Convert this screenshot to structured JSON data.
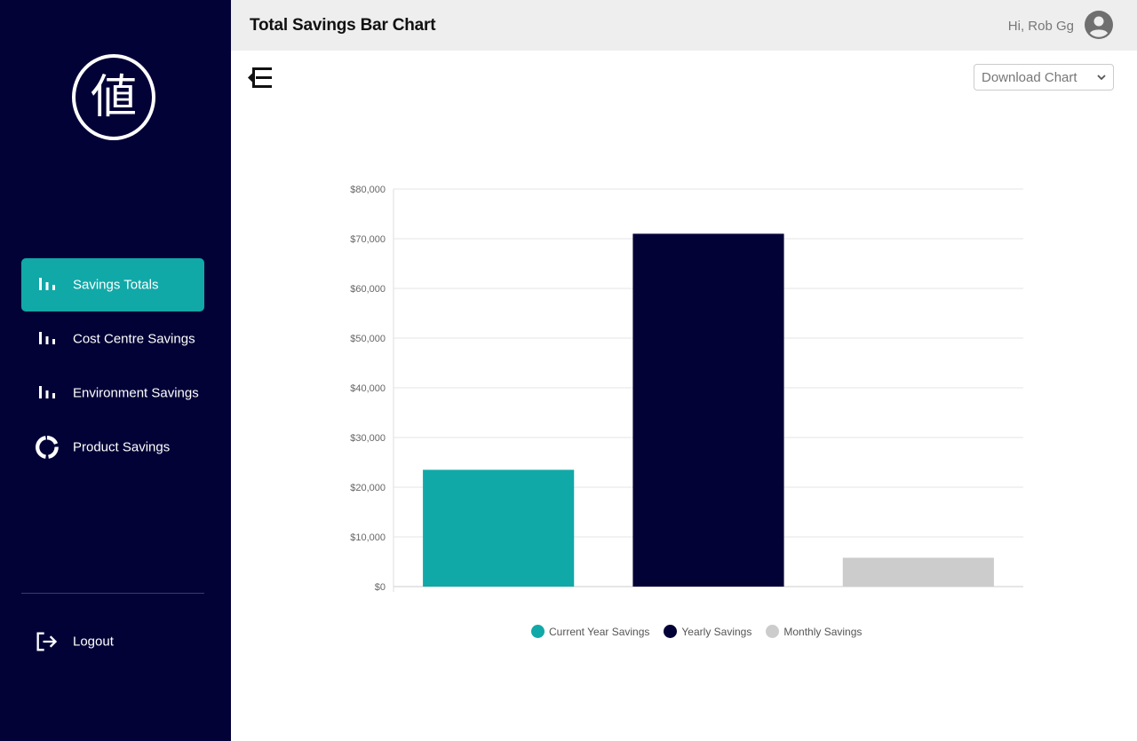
{
  "sidebar": {
    "logo_char": "値",
    "items": [
      {
        "label": "Savings Totals",
        "icon": "bar-chart-icon",
        "active": true
      },
      {
        "label": "Cost Centre Savings",
        "icon": "bar-chart-icon",
        "active": false
      },
      {
        "label": "Environment Savings",
        "icon": "bar-chart-icon",
        "active": false
      },
      {
        "label": "Product Savings",
        "icon": "donut-chart-icon",
        "active": false
      }
    ],
    "logout_label": "Logout"
  },
  "header": {
    "title": "Total Savings Bar Chart",
    "greeting": "Hi, Rob Gg"
  },
  "toolbar": {
    "download_label": "Download Chart"
  },
  "colors": {
    "sidebar_bg": "#020237",
    "accent": "#11a8a8",
    "yearly": "#020237",
    "monthly": "#cccccc"
  },
  "chart_data": {
    "type": "bar",
    "categories": [
      "Current Year Savings",
      "Yearly Savings",
      "Monthly Savings"
    ],
    "values": [
      23500,
      71000,
      5800
    ],
    "colors": [
      "#11a8a8",
      "#020237",
      "#cccccc"
    ],
    "ylim": [
      0,
      80000
    ],
    "yticks": [
      "$0",
      "$10,000",
      "$20,000",
      "$30,000",
      "$40,000",
      "$50,000",
      "$60,000",
      "$70,000",
      "$80,000"
    ],
    "grid": true,
    "legend": "bottom"
  }
}
